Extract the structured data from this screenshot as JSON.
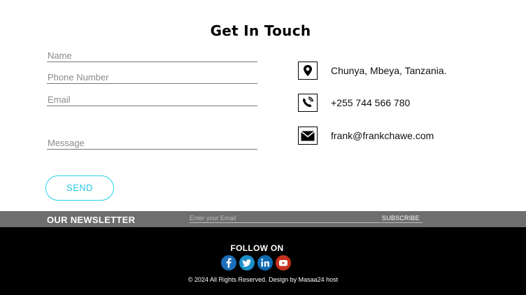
{
  "contact": {
    "title": "Get In Touch",
    "fields": {
      "name_placeholder": "Name",
      "phone_placeholder": "Phone Number",
      "email_placeholder": "Email",
      "message_placeholder": "Message"
    },
    "send_label": "SEND",
    "accent_color": "#22d3e6"
  },
  "info": {
    "address": "Chunya, Mbeya, Tanzania.",
    "phone": "+255 744 566 780",
    "email": "frank@frankchawe.com",
    "icons": [
      "map-pin-icon",
      "phone-icon",
      "envelope-icon"
    ]
  },
  "newsletter": {
    "title": "OUR NEWSLETTER",
    "input_placeholder": "Enter your Email",
    "subscribe_label": "SUBSCRIBE",
    "bar_color": "#6e6e6e"
  },
  "footer": {
    "follow_label": "FOLLOW ON",
    "socials": [
      {
        "icon": "facebook-icon",
        "glyph": "f",
        "color": "#1c6fb8"
      },
      {
        "icon": "twitter-icon",
        "glyph": "t",
        "color": "#1c8fc9"
      },
      {
        "icon": "linkedin-icon",
        "glyph": "in",
        "color": "#0f6bb0"
      },
      {
        "icon": "youtube-icon",
        "glyph": "yt",
        "color": "#c7301d"
      }
    ],
    "copyright": "© 2024 All Rights Reserved. Design by Masaa24 host"
  }
}
